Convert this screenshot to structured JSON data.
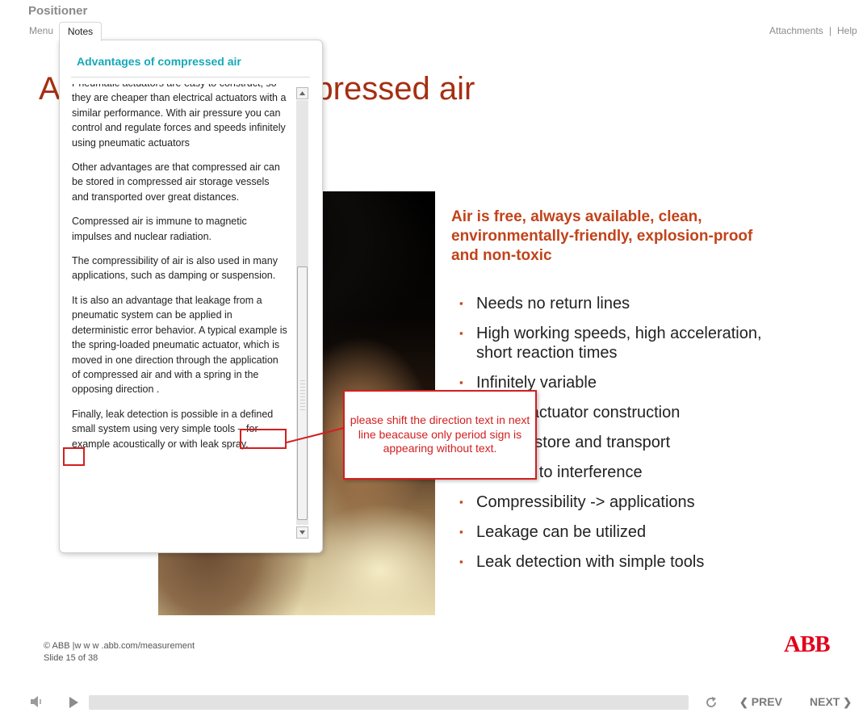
{
  "app": {
    "title": "Positioner"
  },
  "top_nav": {
    "menu": "Menu",
    "notes": "Notes",
    "attachments": "Attachments",
    "separator": "|",
    "help": "Help"
  },
  "slide": {
    "title": "Advantages of compressed air",
    "heading": "Air is free, always available, clean, environmentally-friendly, explosion-proof and non-toxic",
    "bullet_marker": "▪",
    "bullets": [
      "Needs no return lines",
      "High working speeds, high acceleration, short reaction times",
      "Infinitely variable",
      "Simple actuator construction",
      "Easy to store and transport",
      "Immune to interference",
      "Compressibility -> applications",
      "Leakage can be utilized",
      "Leak detection with simple tools"
    ]
  },
  "notes": {
    "title": "Advantages of compressed air",
    "paragraphs": [
      "Pneumatic actuators are easy to construct, so they are cheaper than electrical actuators with a similar performance. With air pressure you can control and regulate forces and speeds infinitely using pneumatic actuators",
      "Other advantages are that compressed air can be stored in compressed air storage vessels and transported over great distances.",
      "Compressed air is immune to magnetic impulses and nuclear radiation.",
      "The compressibility of air is also used in many applications, such as damping or suspension.",
      "It is also an advantage that leakage from a pneumatic system can be applied in deterministic error behavior. A typical example is the spring-loaded pneumatic actuator, which is moved in one direction through the application of compressed air and with a spring in the opposing direction .",
      "Finally, leak detection is possible in a defined small system using very simple tools – for example acoustically or with leak spray."
    ]
  },
  "annotation": {
    "text": "please shift the direction text in next line beacause only period sign is appearing without text.",
    "color": "#d31f1f"
  },
  "footer": {
    "copyright": "© ABB |w w w .abb.com/measurement",
    "slide_counter": "Slide 15 of 38",
    "logo": "ABB"
  },
  "player": {
    "progress": 0.0,
    "prev": "PREV",
    "next": "NEXT",
    "prev_chevron": "❮",
    "next_chevron": "❯",
    "icons": [
      "speaker-icon",
      "play-icon",
      "replay-icon"
    ]
  },
  "colors": {
    "accent": "#c1431a",
    "title": "#a52f12",
    "notes_title": "#16a9b8",
    "logo": "#e2001a"
  }
}
